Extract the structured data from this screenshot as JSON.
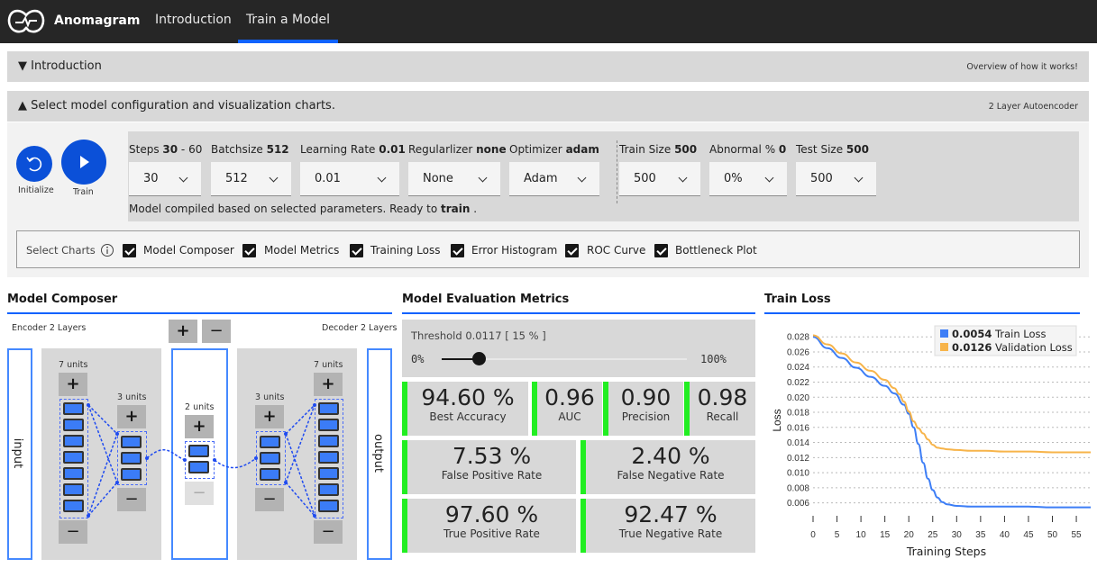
{
  "app": {
    "name": "Anomagram",
    "logo_icon": "anomagram-logo-icon"
  },
  "nav": {
    "tabs": [
      {
        "label": "Introduction",
        "active": false
      },
      {
        "label": "Train a Model",
        "active": true
      }
    ]
  },
  "intro_panel": {
    "title": "▼ Introduction",
    "right_text": "Overview of how it works!"
  },
  "config_panel": {
    "title": "▲ Select model configuration and visualization charts.",
    "right_text": "2 Layer Autoencoder"
  },
  "actions": {
    "initialize_label": "Initialize",
    "train_label": "Train"
  },
  "params": [
    {
      "name": "Steps",
      "bold": "30",
      "suffix": " - 60",
      "value": "30"
    },
    {
      "name": "Batchsize",
      "bold": "512",
      "suffix": "",
      "value": "512"
    },
    {
      "name": "Learning Rate",
      "bold": "0.01",
      "suffix": "",
      "value": "0.01"
    },
    {
      "name": "Regularlizer",
      "bold": "none",
      "suffix": "",
      "value": "None"
    },
    {
      "name": "Optimizer",
      "bold": "adam",
      "suffix": "",
      "value": "Adam"
    },
    {
      "name": "Train Size",
      "bold": "500",
      "suffix": "",
      "value": "500"
    },
    {
      "name": "Abnormal %",
      "bold": "0",
      "suffix": "",
      "value": "0%"
    },
    {
      "name": "Test Size",
      "bold": "500",
      "suffix": "",
      "value": "500"
    }
  ],
  "status": {
    "prefix": "Model compiled based on selected parameters. Ready to ",
    "bold": "train",
    "suffix": " ."
  },
  "select_charts": {
    "label": "Select Charts",
    "options": [
      {
        "label": "Model Composer",
        "checked": true
      },
      {
        "label": "Model Metrics",
        "checked": true
      },
      {
        "label": "Training Loss",
        "checked": true
      },
      {
        "label": "Error Histogram",
        "checked": true
      },
      {
        "label": "ROC Curve",
        "checked": true
      },
      {
        "label": "Bottleneck Plot",
        "checked": true
      }
    ]
  },
  "composer": {
    "title": "Model Composer",
    "encoder_label": "Encoder 2 Layers",
    "decoder_label": "Decoder 2 Layers",
    "input_label": "input",
    "output_label": "output",
    "plus": "+",
    "minus": "−",
    "encoder_layers": [
      {
        "units_label": "7 units",
        "units": 7
      },
      {
        "units_label": "3 units",
        "units": 3
      }
    ],
    "bottleneck": {
      "units_label": "2 units",
      "units": 2
    },
    "decoder_layers": [
      {
        "units_label": "3 units",
        "units": 3
      },
      {
        "units_label": "7 units",
        "units": 7
      }
    ]
  },
  "metrics": {
    "title": "Model Evaluation Metrics",
    "threshold_label": "Threshold 0.0117 [ 15 % ]",
    "slider_min": "0%",
    "slider_max": "100%",
    "slider_value_percent": 15,
    "tiles": [
      {
        "value": "94.60 %",
        "label": "Best Accuracy"
      },
      {
        "value": "0.96",
        "label": "AUC"
      },
      {
        "value": "0.90",
        "label": "Precision"
      },
      {
        "value": "0.98",
        "label": "Recall"
      },
      {
        "value": "7.53 %",
        "label": "False Positive Rate"
      },
      {
        "value": "2.40 %",
        "label": "False Negative Rate"
      },
      {
        "value": "97.60 %",
        "label": "True Positive Rate"
      },
      {
        "value": "92.47 %",
        "label": "True Negative Rate"
      }
    ],
    "accent_color": "#22ee22"
  },
  "chart_data": {
    "type": "line",
    "title": "Train Loss",
    "xlabel": "Training Steps",
    "ylabel": "Loss",
    "xlim": [
      0,
      58
    ],
    "ylim": [
      0.005,
      0.0285
    ],
    "xticks": [
      0,
      5,
      10,
      15,
      20,
      25,
      30,
      35,
      40,
      45,
      50,
      55
    ],
    "yticks": [
      "0.006",
      "0.008",
      "0.010",
      "0.012",
      "0.014",
      "0.016",
      "0.018",
      "0.020",
      "0.022",
      "0.024",
      "0.026",
      "0.028"
    ],
    "grid": true,
    "legend_position": "top-right",
    "series": [
      {
        "name": "Train Loss",
        "legend_value": "0.0054",
        "color": "#3d7ef6",
        "x": [
          0,
          3,
          6,
          9,
          12,
          15,
          17,
          19,
          20,
          21,
          22,
          23,
          24,
          25,
          26,
          27,
          28,
          30,
          33,
          36,
          40,
          45,
          50,
          55,
          58
        ],
        "y": [
          0.028,
          0.0265,
          0.0252,
          0.0239,
          0.0227,
          0.0215,
          0.0205,
          0.019,
          0.0178,
          0.016,
          0.0138,
          0.0113,
          0.0092,
          0.0077,
          0.0067,
          0.0061,
          0.0058,
          0.0056,
          0.0055,
          0.0055,
          0.0055,
          0.0055,
          0.0054,
          0.0054,
          0.0054
        ]
      },
      {
        "name": "Validation Loss",
        "legend_value": "0.0126",
        "color": "#f7b44a",
        "x": [
          0,
          3,
          6,
          9,
          12,
          15,
          17,
          18,
          19,
          20,
          21,
          22,
          23,
          24,
          25,
          26,
          27,
          28,
          30,
          33,
          36,
          40,
          45,
          50,
          55,
          58
        ],
        "y": [
          0.0282,
          0.027,
          0.0258,
          0.0246,
          0.0235,
          0.0223,
          0.0212,
          0.0204,
          0.0194,
          0.0181,
          0.0168,
          0.0159,
          0.0152,
          0.0144,
          0.0137,
          0.0133,
          0.0132,
          0.0131,
          0.013,
          0.0129,
          0.0129,
          0.0128,
          0.0128,
          0.0127,
          0.0127,
          0.0127
        ]
      }
    ]
  }
}
